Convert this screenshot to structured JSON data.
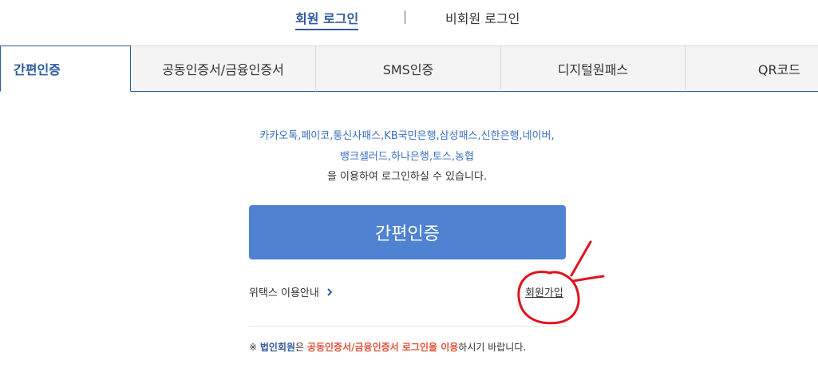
{
  "top_tabs": {
    "member_login": "회원 로그인",
    "guest_login": "비회원 로그인"
  },
  "auth_tabs": [
    {
      "label": "간편인증"
    },
    {
      "label": "공동인증서/금융인증서"
    },
    {
      "label": "SMS인증"
    },
    {
      "label": "디지털원패스"
    },
    {
      "label": "QR코드"
    }
  ],
  "simple_auth": {
    "providers_line1": "카카오톡,페이코,통신사패스,KB국민은행,삼성패스,신한은행,네이버,",
    "providers_line2": "뱅크샐러드,하나은행,토스,농협",
    "description": "을 이용하여 로그인하실 수 있습니다.",
    "button_label": "간편인증",
    "guide_link": "위택스 이용안내",
    "signup_link": "회원가입"
  },
  "notice": {
    "prefix": "※ ",
    "corp": "법인회원",
    "mid": "은 ",
    "cert": "공동인증서/금융인증서 로그인을 이용",
    "suffix": "하시기 바랍니다."
  },
  "colors": {
    "accent": "#2f5a9e",
    "button": "#4f82d1",
    "provider_text": "#3a6fc2",
    "notice_highlight": "#e0543b",
    "annotation": "#e0141e"
  }
}
